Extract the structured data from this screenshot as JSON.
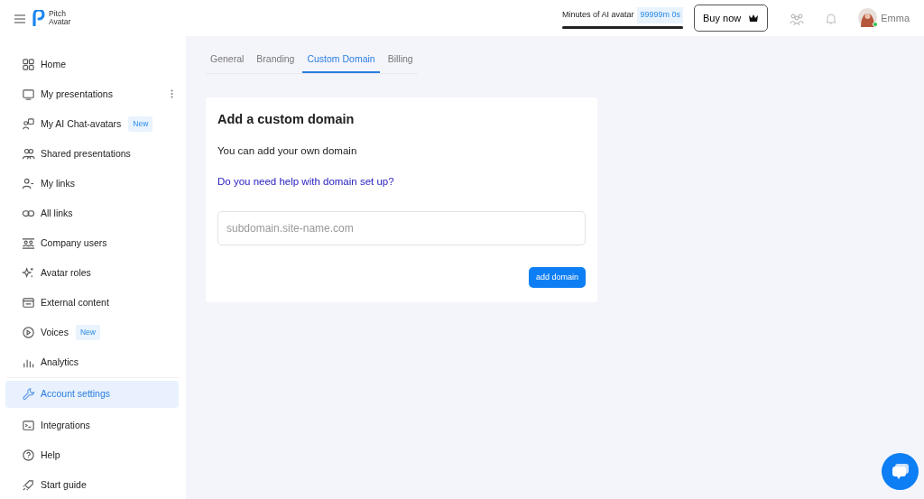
{
  "header": {
    "logo": [
      "Pitch",
      "Avatar"
    ],
    "minutes_label": "Minutes of AI avatar",
    "minutes_value": "99999m 0s",
    "minutes_bar": {
      "level": 1
    },
    "buy_button": "Buy now",
    "user": {
      "name": "Emma",
      "online": true
    }
  },
  "sidebar": {
    "items": [
      {
        "label": "Home",
        "selected": false
      },
      {
        "label": "My presentations",
        "selected": false,
        "menu": true
      },
      {
        "label": "My AI Chat-avatars",
        "selected": false,
        "badge": "New"
      },
      {
        "label": "Shared presentations",
        "selected": false
      },
      {
        "label": "My links",
        "selected": false
      },
      {
        "label": "All links",
        "selected": false
      },
      {
        "label": "Company users",
        "selected": false
      },
      {
        "label": "Avatar roles",
        "selected": false
      },
      {
        "label": "External content",
        "selected": false
      },
      {
        "label": "Voices",
        "selected": false,
        "badge": "New"
      },
      {
        "label": "Analytics",
        "selected": false
      },
      {
        "label": "Account settings",
        "selected": true
      },
      {
        "label": "Integrations",
        "selected": false
      },
      {
        "label": "Help",
        "selected": false
      },
      {
        "label": "Start guide",
        "selected": false
      }
    ]
  },
  "tabs": [
    {
      "label": "General",
      "selected": false
    },
    {
      "label": "Branding",
      "selected": false
    },
    {
      "label": "Custom Domain",
      "selected": true
    },
    {
      "label": "Billing",
      "selected": false
    }
  ],
  "card": {
    "title": "Add a custom domain",
    "text": "You can add your own domain",
    "help_link": "Do you need help with domain set up?",
    "domain_field": {
      "placeholder": "subdomain.site-name.com"
    },
    "button": "add domain"
  }
}
